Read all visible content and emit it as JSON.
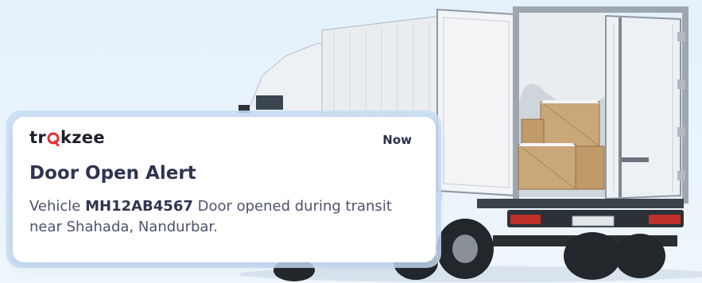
{
  "notification": {
    "brand_prefix": "tr",
    "brand_suffix": "kzee",
    "brand_pin_color": "#e3302f",
    "time": "Now",
    "title": "Door Open Alert",
    "body_prefix": "Vehicle ",
    "vehicle_number": "MH12AB4567",
    "body_suffix": " Door opened during transit near Shahada, Nandurbar."
  }
}
